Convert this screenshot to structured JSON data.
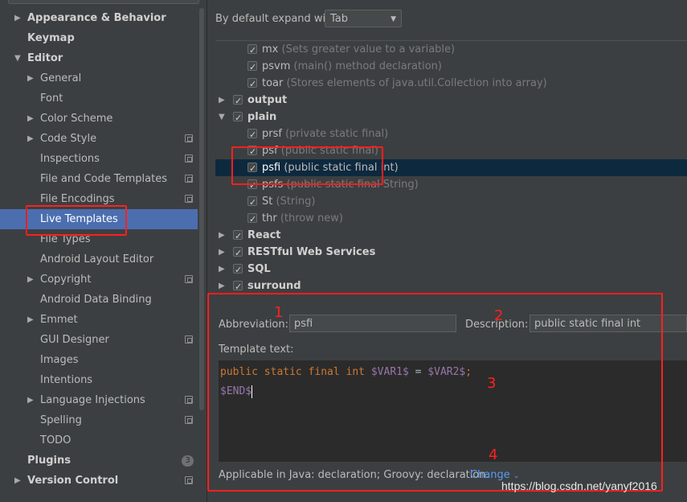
{
  "sidebar": {
    "items": [
      {
        "label": "Appearance & Behavior",
        "bold": true,
        "arrow": "right",
        "indent": 0
      },
      {
        "label": "Keymap",
        "bold": true,
        "arrow": "",
        "indent": 0
      },
      {
        "label": "Editor",
        "bold": true,
        "arrow": "down",
        "indent": 0
      },
      {
        "label": "General",
        "bold": false,
        "arrow": "right",
        "indent": 1
      },
      {
        "label": "Font",
        "bold": false,
        "arrow": "",
        "indent": 1
      },
      {
        "label": "Color Scheme",
        "bold": false,
        "arrow": "right",
        "indent": 1
      },
      {
        "label": "Code Style",
        "bold": false,
        "arrow": "right",
        "indent": 1,
        "project": true
      },
      {
        "label": "Inspections",
        "bold": false,
        "arrow": "",
        "indent": 1,
        "project": true
      },
      {
        "label": "File and Code Templates",
        "bold": false,
        "arrow": "",
        "indent": 1,
        "project": true
      },
      {
        "label": "File Encodings",
        "bold": false,
        "arrow": "",
        "indent": 1,
        "project": true
      },
      {
        "label": "Live Templates",
        "bold": false,
        "arrow": "",
        "indent": 1,
        "selected": true
      },
      {
        "label": "File Types",
        "bold": false,
        "arrow": "",
        "indent": 1
      },
      {
        "label": "Android Layout Editor",
        "bold": false,
        "arrow": "",
        "indent": 1
      },
      {
        "label": "Copyright",
        "bold": false,
        "arrow": "right",
        "indent": 1,
        "project": true
      },
      {
        "label": "Android Data Binding",
        "bold": false,
        "arrow": "",
        "indent": 1
      },
      {
        "label": "Emmet",
        "bold": false,
        "arrow": "right",
        "indent": 1
      },
      {
        "label": "GUI Designer",
        "bold": false,
        "arrow": "",
        "indent": 1,
        "project": true
      },
      {
        "label": "Images",
        "bold": false,
        "arrow": "",
        "indent": 1
      },
      {
        "label": "Intentions",
        "bold": false,
        "arrow": "",
        "indent": 1
      },
      {
        "label": "Language Injections",
        "bold": false,
        "arrow": "right",
        "indent": 1,
        "project": true
      },
      {
        "label": "Spelling",
        "bold": false,
        "arrow": "",
        "indent": 1,
        "project": true
      },
      {
        "label": "TODO",
        "bold": false,
        "arrow": "",
        "indent": 1
      },
      {
        "label": "Plugins",
        "bold": true,
        "arrow": "",
        "indent": 0,
        "badge": "3"
      },
      {
        "label": "Version Control",
        "bold": true,
        "arrow": "right",
        "indent": 0,
        "project": true
      }
    ]
  },
  "expand": {
    "label": "By default expand with",
    "value": "Tab"
  },
  "tree": {
    "rows": [
      {
        "abbr": "mx",
        "desc": "(Sets greater value to a variable)",
        "level": 1
      },
      {
        "abbr": "psvm",
        "desc": "(main() method declaration)",
        "level": 1
      },
      {
        "abbr": "toar",
        "desc": "(Stores elements of java.util.Collection into array)",
        "level": 1
      },
      {
        "abbr": "output",
        "desc": "",
        "level": 0,
        "arrow": "right"
      },
      {
        "abbr": "plain",
        "desc": "",
        "level": 0,
        "arrow": "down"
      },
      {
        "abbr": "prsf",
        "desc": "(private static final)",
        "level": 1
      },
      {
        "abbr": "psf",
        "desc": "(public static final)",
        "level": 1
      },
      {
        "abbr": "psfi",
        "desc": "(public static final int)",
        "level": 1,
        "selected": true
      },
      {
        "abbr": "psfs",
        "desc": "(public static final String)",
        "level": 1
      },
      {
        "abbr": "St",
        "desc": "(String)",
        "level": 1
      },
      {
        "abbr": "thr",
        "desc": "(throw new)",
        "level": 1
      },
      {
        "abbr": "React",
        "desc": "",
        "level": 0,
        "arrow": "right"
      },
      {
        "abbr": "RESTful Web Services",
        "desc": "",
        "level": 0,
        "arrow": "right"
      },
      {
        "abbr": "SQL",
        "desc": "",
        "level": 0,
        "arrow": "right"
      },
      {
        "abbr": "surround",
        "desc": "",
        "level": 0,
        "arrow": "right"
      }
    ]
  },
  "editor": {
    "abbreviation_label": "Abbreviation:",
    "abbreviation_value": "psfi",
    "description_label": "Description:",
    "description_value": "public static final int",
    "template_label": "Template text:",
    "code_line1": {
      "kw": "public static final int ",
      "v1": "$VAR1$",
      "mid": " = ",
      "v2": "$VAR2$",
      "end": ";"
    },
    "code_line2": {
      "v": "$END$"
    },
    "applicable_text": "Applicable in Java: declaration; Groovy: declaration.",
    "change_label": "Change"
  },
  "annotations": {
    "n1": "1",
    "n2": "2",
    "n3": "3",
    "n4": "4"
  },
  "watermark": "https://blog.csdn.net/yanyf2016",
  "colors": {
    "accent": "#4b6eaf",
    "annotation": "#ff1f1f",
    "keyword": "#cc7832",
    "template_var": "#9876aa"
  }
}
